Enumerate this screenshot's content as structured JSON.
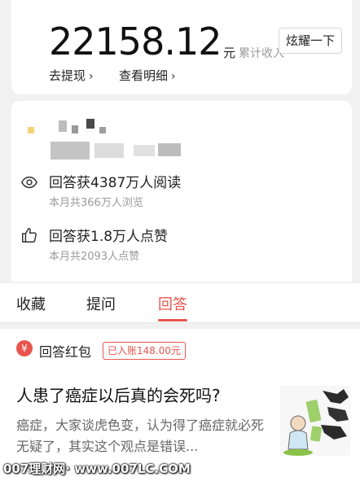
{
  "earnings": {
    "amount": "22158.12",
    "currency_unit": "元",
    "cumulative_label": "累计收入",
    "show_off_button": "炫耀一下",
    "withdraw_link": "去提现",
    "details_link": "查看明细",
    "chevron": "›"
  },
  "stats": {
    "reads": {
      "main": "回答获4387万人阅读",
      "sub": "本月共366万人浏览",
      "icon": "eye-icon"
    },
    "likes": {
      "main": "回答获1.8万人点赞",
      "sub": "本月共2093人点赞",
      "icon": "thumbs-up-icon"
    }
  },
  "tabs": [
    {
      "label": "收藏",
      "active": false
    },
    {
      "label": "提问",
      "active": false
    },
    {
      "label": "回答",
      "active": true
    }
  ],
  "feed": {
    "red_packet_icon": "¥",
    "red_packet_label": "回答红包",
    "credited_badge": "已入账148.00元",
    "question_title": "人患了癌症以后真的会死吗?",
    "excerpt": "癌症，大家谈虎色变，认为得了癌症就必死无疑了，其实这个观点是错误..."
  },
  "watermark": "007理财网· www.007LC.COM",
  "colors": {
    "accent": "#e8554e",
    "background": "#f1f1f1"
  }
}
